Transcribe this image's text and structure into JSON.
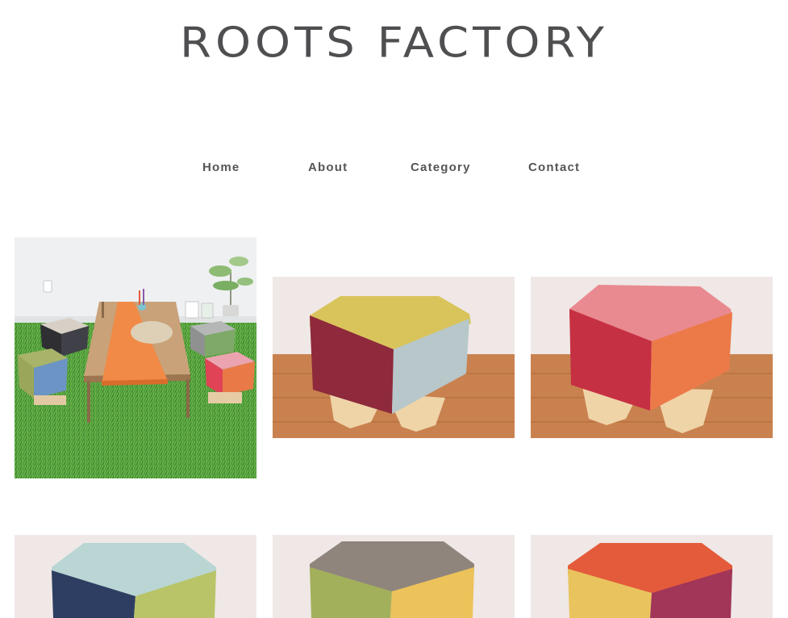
{
  "site": {
    "logo_text": "ROOTS FACTORY"
  },
  "nav": {
    "items": [
      {
        "label": "Home"
      },
      {
        "label": "About"
      },
      {
        "label": "Category"
      },
      {
        "label": "Contact"
      }
    ]
  },
  "gallery": {
    "items": [
      {
        "subject": "room-with-table-and-stools",
        "colors": {
          "top": "#c9b8a0",
          "front": "#f07e3c",
          "side": "#64a84a"
        }
      },
      {
        "subject": "stool",
        "colors": {
          "top": "#d9c45c",
          "front": "#8e2a3c",
          "side": "#b7c7ca"
        }
      },
      {
        "subject": "stool",
        "colors": {
          "top": "#e98a90",
          "front": "#c63043",
          "side": "#ec7a49"
        }
      },
      {
        "subject": "stool",
        "colors": {
          "top": "#b9d6d4",
          "front": "#2e3e62",
          "side": "#b9c468"
        }
      },
      {
        "subject": "stool",
        "colors": {
          "top": "#8f857d",
          "front": "#a3b05b",
          "side": "#ecc25a"
        }
      },
      {
        "subject": "stool",
        "colors": {
          "top": "#e45b3b",
          "front": "#e9c45e",
          "side": "#a13658"
        }
      }
    ]
  }
}
